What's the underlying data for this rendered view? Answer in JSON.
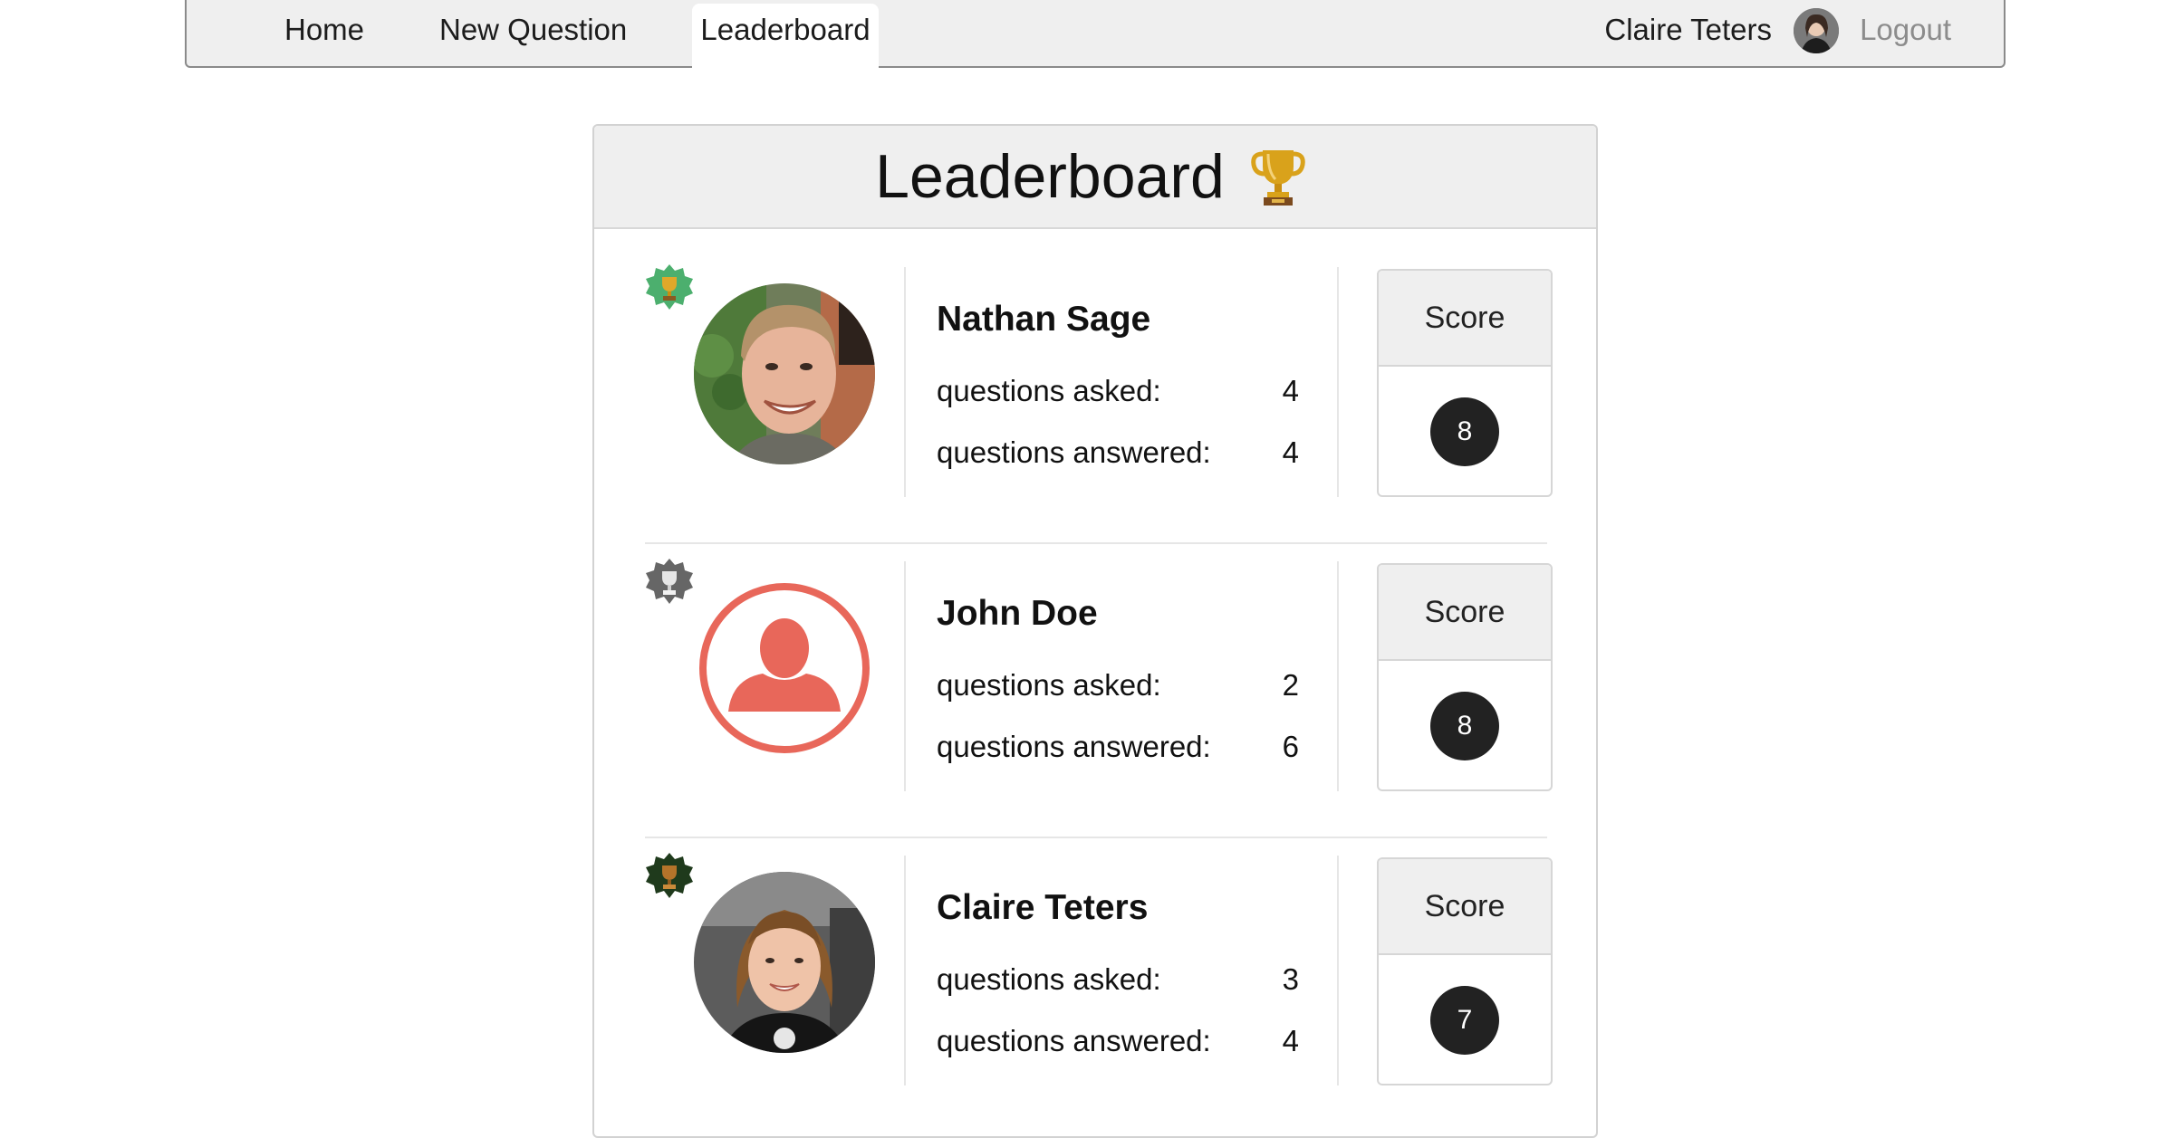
{
  "nav": {
    "home": "Home",
    "new_question": "New Question",
    "leaderboard": "Leaderboard",
    "user_name": "Claire Teters",
    "logout": "Logout"
  },
  "leaderboard": {
    "title": "Leaderboard",
    "entries": [
      {
        "rank_badge_color": "#4caf6e",
        "avatar": "photo",
        "name": "Nathan Sage",
        "asked_label": "questions asked:",
        "asked": "4",
        "answered_label": "questions answered:",
        "answered": "4",
        "score_label": "Score",
        "score": "8"
      },
      {
        "rank_badge_color": "#666666",
        "avatar": "default-user-icon",
        "name": "John Doe",
        "asked_label": "questions asked:",
        "asked": "2",
        "answered_label": "questions answered:",
        "answered": "6",
        "score_label": "Score",
        "score": "8"
      },
      {
        "rank_badge_color": "#1f3a1c",
        "avatar": "photo",
        "name": "Claire Teters",
        "asked_label": "questions asked:",
        "asked": "3",
        "answered_label": "questions answered:",
        "answered": "4",
        "score_label": "Score",
        "score": "7"
      }
    ]
  },
  "colors": {
    "nav_bg": "#efefef",
    "score_badge": "#222222",
    "default_avatar": "#e8675a",
    "trophy_gold": "#d4a017"
  }
}
